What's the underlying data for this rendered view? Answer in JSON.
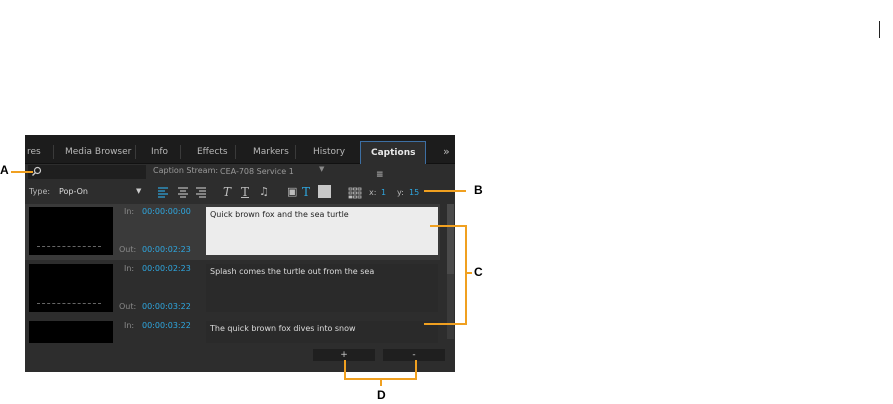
{
  "tabs": [
    "res",
    "Media Browser",
    "Info",
    "Effects",
    "Markers",
    "History",
    "Captions"
  ],
  "tab_menu_glyph": "≡",
  "overflow_glyph": "»",
  "search": {
    "icon": "search-icon",
    "placeholder": ""
  },
  "caption_stream": {
    "label": "Caption Stream:",
    "value": "CEA-708 Service 1"
  },
  "type": {
    "label": "Type:",
    "value": "Pop-On"
  },
  "toolbar": {
    "align_left": "align-left-icon",
    "align_center": "align-center-icon",
    "align_right": "align-right-icon",
    "italic": "T",
    "underline": "T",
    "music": "♫",
    "bg": "▣",
    "text_color": "T",
    "grid_icon": "position-grid-icon"
  },
  "position": {
    "x_label": "x:",
    "x_value": "1",
    "y_label": "y:",
    "y_value": "15"
  },
  "captions": [
    {
      "in_label": "In:",
      "in": "00:00:00:00",
      "out_label": "Out:",
      "out": "00:00:02:23",
      "text": "Quick brown fox and the sea turtle"
    },
    {
      "in_label": "In:",
      "in": "00:00:02:23",
      "out_label": "Out:",
      "out": "00:00:03:22",
      "text": "Splash comes the turtle out from the sea"
    },
    {
      "in_label": "In:",
      "in": "00:00:03:22",
      "out_label": "",
      "out": "",
      "text": "The quick brown fox dives into snow"
    }
  ],
  "buttons": {
    "add": "+",
    "remove": "-"
  },
  "callouts": {
    "a": "A",
    "b": "B",
    "c": "C",
    "d": "D"
  },
  "colors": {
    "accent": "#2ea7e0",
    "callout": "#f0a020"
  }
}
